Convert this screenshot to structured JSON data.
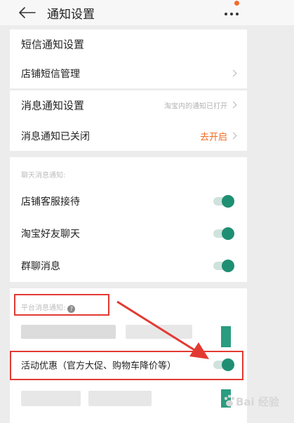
{
  "header": {
    "title": "通知设置"
  },
  "sms_settings": {
    "section_title": "短信通知设置",
    "shop_sms_manage": "店铺短信管理"
  },
  "message_settings": {
    "section_title": "消息通知设置",
    "section_hint": "淘宝内的通知已打开",
    "closed_label": "消息通知已关闭",
    "enable_action": "去开启"
  },
  "chat_notifications": {
    "section_label": "聊天消息通知:",
    "items": [
      {
        "label": "店铺客服接待",
        "enabled": true
      },
      {
        "label": "淘宝好友聊天",
        "enabled": true
      },
      {
        "label": "群聊消息",
        "enabled": true
      }
    ]
  },
  "platform_notifications": {
    "section_label": "平台消息通知:",
    "help_icon_glyph": "?",
    "items": [
      {
        "label": "活动优惠（官方大促、购物车降价等）",
        "enabled": true
      }
    ]
  },
  "watermark": {
    "text": "Bai 经验"
  },
  "colors": {
    "accent_orange": "#f06a1f",
    "toggle_green": "#1f8f73",
    "annotation_red": "#e23a32"
  }
}
